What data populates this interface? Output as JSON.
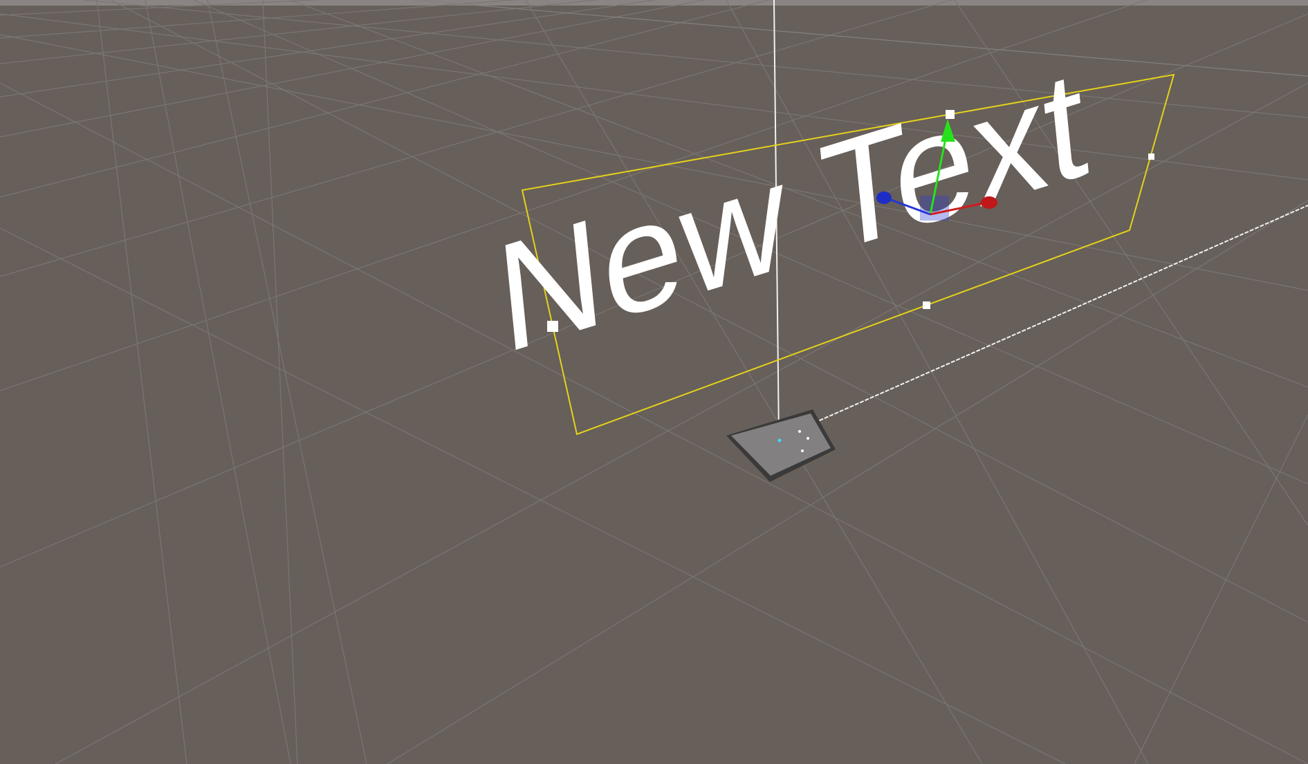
{
  "scene": {
    "background_color": "#675f5a",
    "grid_color": "#7d7874",
    "selection_outline_color": "#e5d21a",
    "handle_color": "#ffffff",
    "text_object": {
      "text": "New Text",
      "color": "#ffffff"
    },
    "gizmo": {
      "y_axis_color": "#27e21b",
      "x_axis_color": "#d01c1c",
      "z_axis_color": "#2436d8"
    },
    "canvas_object": {
      "fill_color": "#828080",
      "border_color": "#3a3a3a"
    }
  }
}
